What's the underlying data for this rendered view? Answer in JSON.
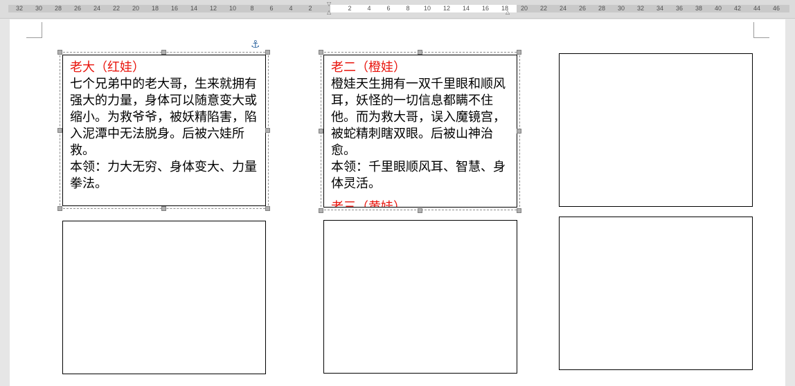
{
  "ruler": {
    "ticks": [
      "32",
      "30",
      "28",
      "26",
      "24",
      "22",
      "20",
      "18",
      "16",
      "14",
      "12",
      "10",
      "8",
      "6",
      "4",
      "2",
      "2",
      "4",
      "6",
      "8",
      "10",
      "12",
      "14",
      "16",
      "18",
      "20",
      "22",
      "24",
      "26",
      "28",
      "30",
      "32",
      "34",
      "36",
      "38",
      "40",
      "42",
      "44",
      "46"
    ]
  },
  "textboxes": [
    {
      "title": "老大（红娃）",
      "body": "七个兄弟中的老大哥，生来就拥有强大的力量，身体可以随意变大或缩小。为救爷爷，被妖精陷害，陷入泥潭中无法脱身。后被六娃所救。",
      "ability": "本领：力大无穷、身体变大、力量拳法。"
    },
    {
      "title": "老二（橙娃）",
      "body": "橙娃天生拥有一双千里眼和顺风耳，妖怪的一切信息都瞒不住他。而为救大哥，误入魔镜宫，被蛇精刺瞎双眼。后被山神治愈。",
      "ability": "本领：千里眼顺风耳、智慧、身体灵活。",
      "overflow_text": "老三（黄娃）"
    }
  ],
  "icons": {
    "anchor": "anchor-icon"
  },
  "colors": {
    "title_red": "#e8140c"
  }
}
